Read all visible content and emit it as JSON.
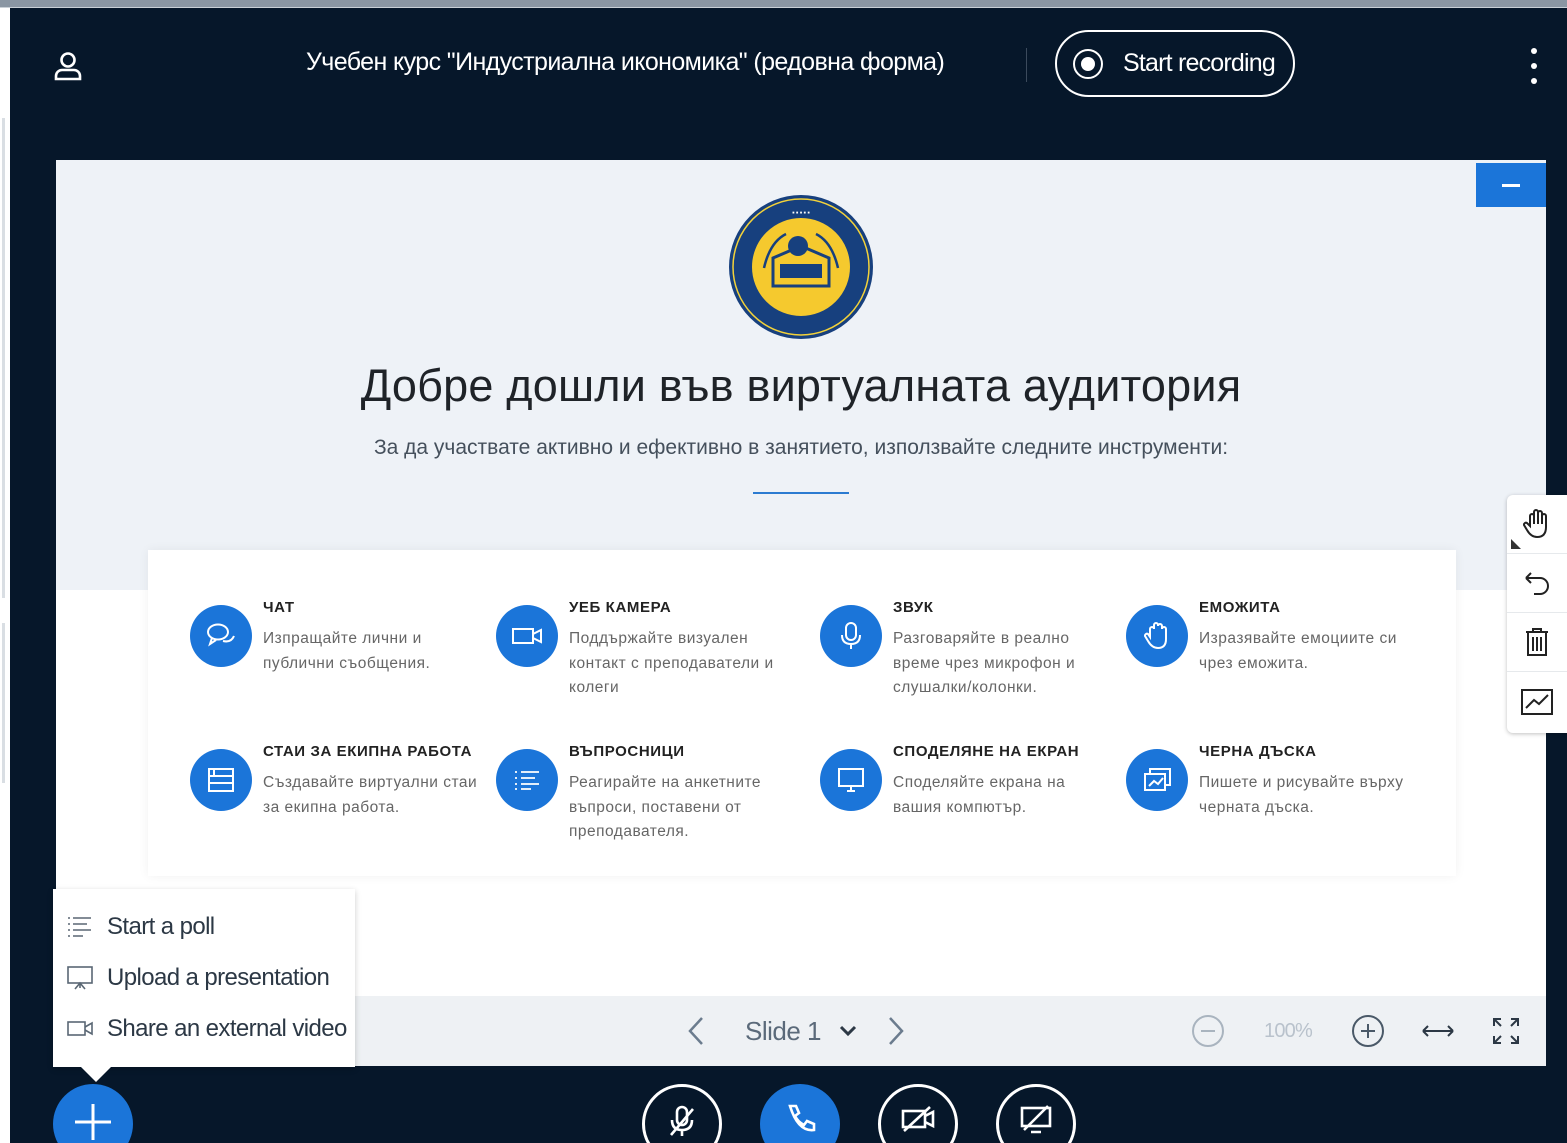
{
  "header": {
    "title": "Учебен курс \"Индустриална икономика\" (редовна форма)",
    "record_label": "Start recording",
    "icons": [
      "user-icon",
      "record-icon",
      "more-options-icon"
    ]
  },
  "slide": {
    "welcome": "Добре дошли във виртуалната аудитория",
    "subtitle": "За да участвате активно и ефективно в занятието, използвайте следните инструменти:",
    "features": [
      {
        "title": "ЧАТ",
        "description": "Изпращайте лични и публични съобщения.",
        "icon": "chat-icon"
      },
      {
        "title": "УЕБ КАМЕРА",
        "description": "Поддържайте визуален контакт с преподаватели и колеги",
        "icon": "video-icon"
      },
      {
        "title": "ЗВУК",
        "description": "Разговаряйте в реално време чрез микрофон и слушалки/колонки.",
        "icon": "microphone-icon"
      },
      {
        "title": "ЕМОЖИТА",
        "description": "Изразявайте емоциите си чрез еможита.",
        "icon": "hand-icon"
      },
      {
        "title": "СТАИ ЗА ЕКИПНА РАБОТА",
        "description": "Създавайте виртуални стаи за екипна работа.",
        "icon": "breakout-rooms-icon"
      },
      {
        "title": "ВЪПРОСНИЦИ",
        "description": "Реагирайте на анкетните въпроси, поставени от преподавателя.",
        "icon": "poll-list-icon"
      },
      {
        "title": "СПОДЕЛЯНЕ НА ЕКРАН",
        "description": "Споделяйте екрана на вашия компютър.",
        "icon": "desktop-icon"
      },
      {
        "title": "ЧЕРНА ДЪСКА",
        "description": "Пишете и рисувайте върху черната дъска.",
        "icon": "whiteboard-icon"
      }
    ]
  },
  "presentation_toolbar": {
    "slide_label": "Slide 1",
    "zoom": "100%"
  },
  "actions_menu": {
    "items": [
      {
        "label": "Start a poll",
        "icon": "poll-icon"
      },
      {
        "label": "Upload a presentation",
        "icon": "presentation-icon"
      },
      {
        "label": "Share an external video",
        "icon": "external-video-icon"
      }
    ]
  },
  "whiteboard_tools": [
    "hand-pan-icon",
    "undo-icon",
    "trash-icon",
    "multi-user-icon"
  ],
  "colors": {
    "background": "#06172a",
    "accent": "#1b75d9",
    "slide_top": "#eef2f7"
  }
}
